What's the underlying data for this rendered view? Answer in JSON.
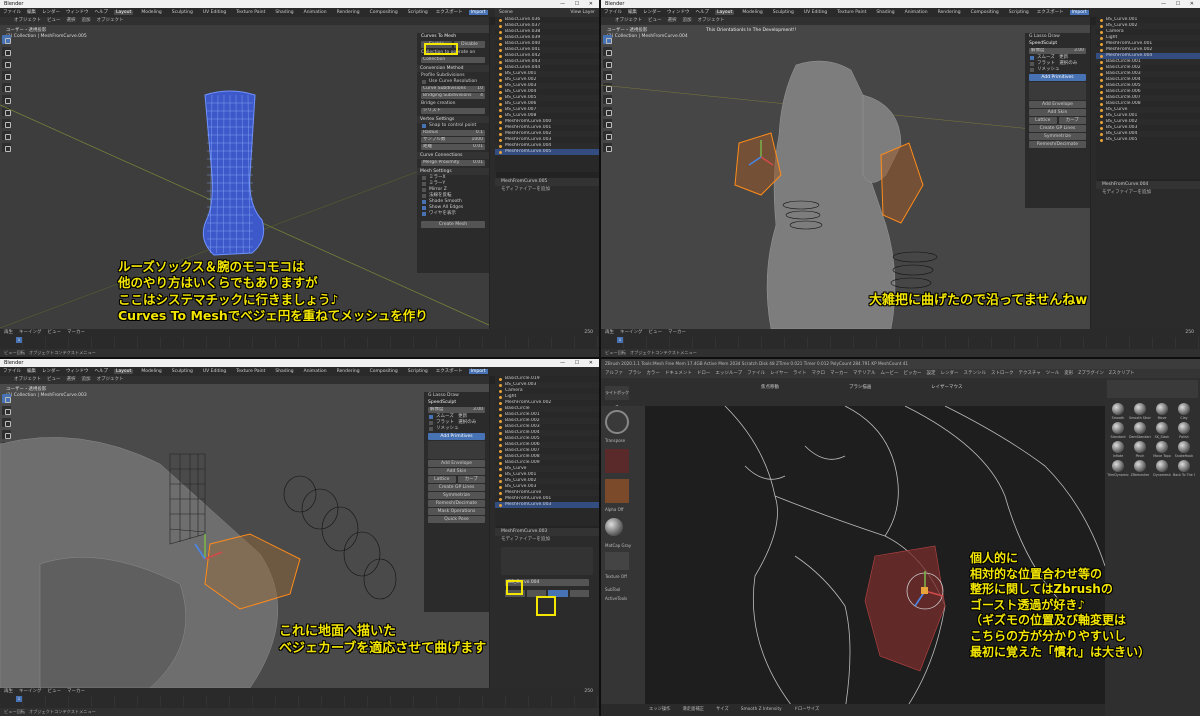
{
  "blender": {
    "title": "Blender",
    "menu": [
      "ファイル",
      "編集",
      "レンダー",
      "ウィンドウ",
      "ヘルプ"
    ],
    "workspaces": [
      "Layout",
      "Modeling",
      "Sculpting",
      "UV Editing",
      "Texture Paint",
      "Shading",
      "Animation",
      "Rendering",
      "Compositing",
      "Scripting"
    ],
    "export_label": "エクスポート",
    "import_label": "Import",
    "scene_label": "Scene",
    "view_layer_label": "View Layer",
    "viewport_menu": [
      "オブジェクト",
      "ビュー",
      "選択",
      "追加",
      "オブジェクト"
    ],
    "view_info": "ユーザー・透視投影",
    "timeline_menu": [
      "再生",
      "キーイング",
      "ビュー",
      "マーカー"
    ],
    "timeline_start": "1",
    "timeline_end": "250",
    "status_left": "ビュー回転",
    "status_mid": "オブジェクトコンテクストメニュー"
  },
  "q1": {
    "collection_info": "(1) Collection | MeshFromCurve.005",
    "panel": {
      "title": "Curves To Mesh",
      "btn_enable": "Enable",
      "btn_disable": "Disable",
      "collection_label": "Collection to operate on",
      "collection_value": "Collection",
      "conversion": "Conversion Method",
      "profile_sub": "Profile Subdivisions",
      "use_curve_res": "Use Curve Resolution",
      "curve_sub": "Curve Subdivisions",
      "bridging_sub": "Bridging Subdivisions",
      "bridge_creation": "Bridge creation",
      "bridge_value": "シリズト",
      "vertex_settings": "Vertex Settings",
      "snap": "Snap to control point",
      "radius": "Radius",
      "samples": "サンプル数",
      "distance": "距離",
      "curve_conn": "Curve Connections",
      "merge_prox": "Merge Proximity",
      "mesh_settings": "Mesh Settings",
      "mirror_x": "ミラーX",
      "mirror_y": "ミラーY",
      "mirror_z": "Mirror Z",
      "flip_normals": "法線を反転",
      "shade_smooth": "Shade Smooth",
      "show_all_edges": "Show All Edges",
      "wire_display": "ワイヤを表示",
      "create_mesh": "Create Mesh",
      "curve_sub_val": "10",
      "bridging_sub_val": "4",
      "radius_val": "0.1",
      "samples_val": "1000",
      "distance_val": "0.01",
      "merge_val": "0.01"
    },
    "outliner_items": [
      "BasicCurve.036",
      "BasicCurve.037",
      "BasicCurve.038",
      "BasicCurve.039",
      "BasicCurve.040",
      "BasicCurve.041",
      "BasicCurve.042",
      "BasicCurve.043",
      "BasicCurve.044",
      "BS_Curve.001",
      "BS_Curve.002",
      "BS_Curve.003",
      "BS_Curve.004",
      "BS_Curve.005",
      "BS_Curve.006",
      "BS_Curve.007",
      "BS_Curve.008",
      "MeshFromCurve.000",
      "MeshFromCurve.001",
      "MeshFromCurve.002",
      "MeshFromCurve.003",
      "MeshFromCurve.004",
      "MeshFromCurve.005"
    ],
    "props_title": "MeshFromCurve.005",
    "props_row": "モディファイアーを追加",
    "caption": [
      "ルーズソックス＆腕のモコモコは",
      "他のやり方はいくらでもありますが",
      "ここはシステマチックに行きましょう♪",
      "Curves To Meshでベジェ円を重ねてメッシュを作り"
    ]
  },
  "q2": {
    "collection_info": "(1) Collection | MeshFromCurve.004",
    "notice": "This OrientationIs In The Development!!",
    "panel": {
      "gp_draw": "G Lasso Draw",
      "speed_sculpt": "SpeedSculpt",
      "resolution": "解像度",
      "resolution_val": "3.00",
      "smooth": "スムーズ",
      "update": "更新",
      "flat": "フラット",
      "only_selected": "選択のみ",
      "remesh": "リメッシュ",
      "add_primitives": "Add Primitives",
      "add_envelope": "Add Envelope",
      "add_skin": "Add Skin",
      "lattice": "Lattice",
      "curve": "カーブ",
      "create_gp_lines": "Create GP Lines",
      "symmetrize": "Symmetrize",
      "remesh_decimate": "Remesh/Decimate",
      "mask_ops": "Mask Operations",
      "quick_pose": "Quick Pose"
    },
    "outliner_items": [
      "BS_Curve.001",
      "BS_Curve.002",
      "Camera",
      "Light",
      "MeshFromCurve.001",
      "MeshFromCurve.002",
      "MeshFromCurve.004",
      "BasicCircle.001",
      "BasicCircle.002",
      "BasicCircle.003",
      "BasicCircle.004",
      "BasicCircle.005",
      "BasicCircle.006",
      "BasicCircle.007",
      "BasicCircle.008",
      "BS_Curve",
      "BS_Curve.001",
      "BS_Curve.002",
      "BS_Curve.003",
      "BS_Curve.004",
      "BS_Curve.005"
    ],
    "props_title": "MeshFromCurve.004",
    "props_row": "モディファイアーを追加",
    "caption": [
      "大雑把に曲げたので沿ってませんねw"
    ]
  },
  "q3": {
    "collection_info": "(1) Collection | MeshFromCurve.003",
    "outliner_items": [
      "BasicCircle.019",
      "BS_Curve.003",
      "Camera",
      "Light",
      "MeshFromCurve.002",
      "BasicCircle",
      "BasicCircle.001",
      "BasicCircle.002",
      "BasicCircle.003",
      "BasicCircle.004",
      "BasicCircle.005",
      "BasicCircle.006",
      "BasicCircle.007",
      "BasicCircle.008",
      "BasicCircle.009",
      "BS_Curve",
      "BS_Curve.001",
      "BS_Curve.002",
      "BS_Curve.003",
      "MeshFromCurve",
      "MeshFromCurve.001",
      "MeshFromCurve.003"
    ],
    "props_title": "MeshFromCurve.003",
    "props_row": "モディファイアーを追加",
    "modifier_field": "BS_Curve.004",
    "caption": [
      "これに地面へ描いた",
      "ベジェカーブを適応させて曲げます"
    ]
  },
  "q4": {
    "top": "ZBrush 2020.1.1  Tools:Mesh  Free Mem 17.4GB  Active Mem 2034  Scratch Disk 48  ZTime 0.021  Timer 0.012  PolyCount 284.791 KP  MeshCount 41",
    "menu": [
      "アルファ",
      "ブラシ",
      "カラー",
      "ドキュメント",
      "ドロー",
      "エッジループ",
      "ファイル",
      "レイヤー",
      "ライト",
      "マクロ",
      "マーカー",
      "マテリアル",
      "ムービー",
      "ピッカー",
      "設定",
      "レンダー",
      "ステンシル",
      "ストローク",
      "テクスチャ",
      "ツール",
      "変形",
      "Zプラグイン",
      "Zスクリプト"
    ],
    "tool_labels": [
      "ライトボックス",
      "焦点移動",
      "ブラシ描画",
      "レイザーマウス"
    ],
    "left_labels": [
      "Transpose",
      "Alpha Off",
      "MatCap Gray",
      "Texture Off",
      "SubTool",
      "ActiveTools"
    ],
    "right_labels": [
      "Smooth",
      "Smooth Stronger",
      "Move",
      "Clay",
      "Standard",
      "DamStandard",
      "SK_Slash",
      "Polish",
      "Inflate",
      "Pinch",
      "Move Topo",
      "SnakeHook",
      "TrimDynamic",
      "ZRemesher",
      "Dynamesh",
      "Back To The Center"
    ],
    "bottom": [
      "エッジ操作",
      "滑走面補正",
      "サイズ",
      "Smooth Z Intensity",
      "ドローサイズ"
    ],
    "caption": [
      "個人的に",
      "相対的な位置合わせ等の",
      "整形に関してはZbrushの",
      "ゴースト透過が好き♪",
      "（ギズモの位置及び軸変更は",
      "こちらの方が分かりやすいし",
      "最初に覚えた「慣れ」は大きい）"
    ]
  },
  "colors": {
    "caption": "#f3e600",
    "select_blue": "#4772b3",
    "curve_orange": "#e8a33a",
    "mesh_blue": "#4b6fe0"
  }
}
